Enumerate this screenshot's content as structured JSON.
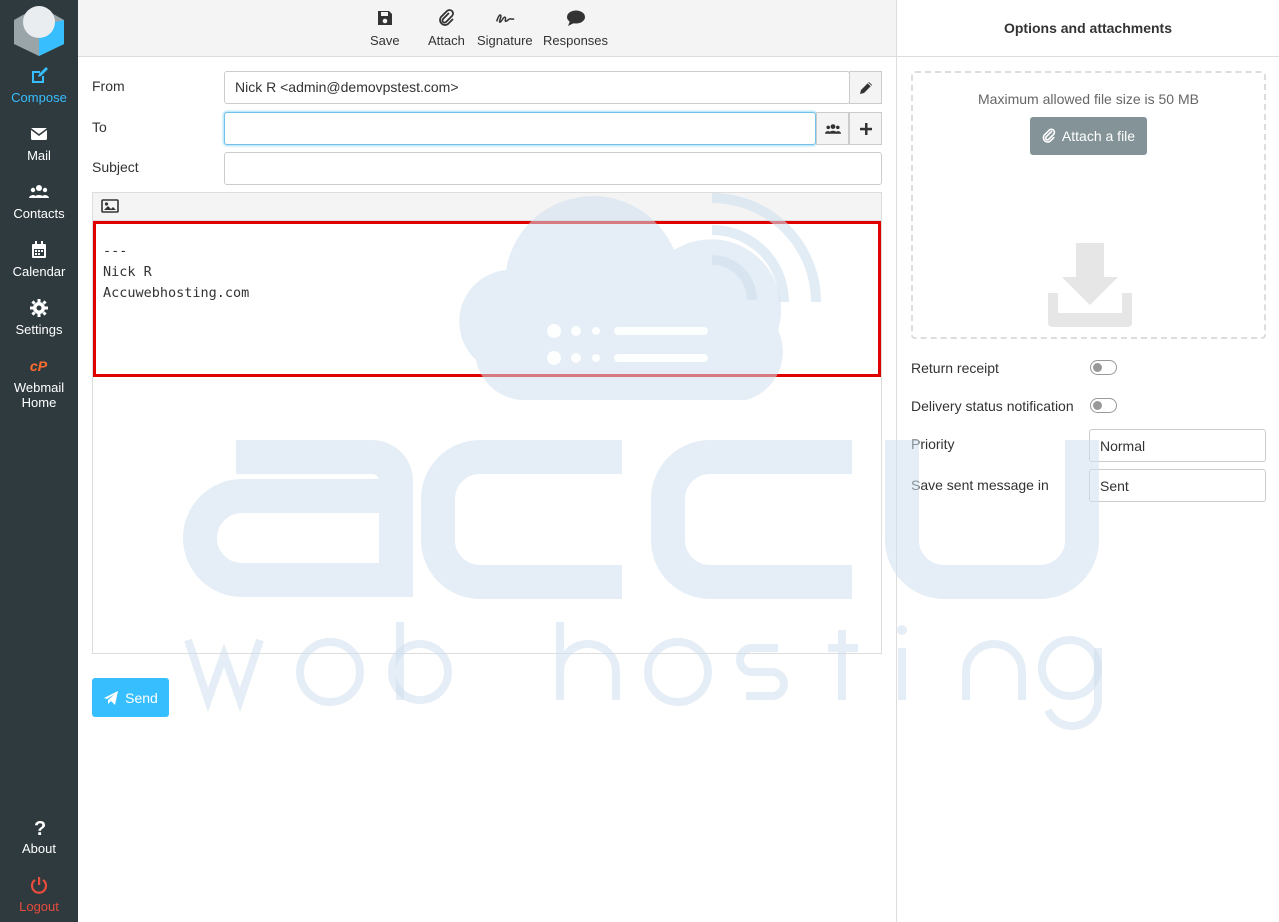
{
  "sidebar": {
    "items": [
      {
        "label": "Compose",
        "icon": "compose-icon"
      },
      {
        "label": "Mail",
        "icon": "envelope-icon"
      },
      {
        "label": "Contacts",
        "icon": "users-icon"
      },
      {
        "label": "Calendar",
        "icon": "calendar-icon"
      },
      {
        "label": "Settings",
        "icon": "gear-icon"
      },
      {
        "label_line1": "Webmail",
        "label_line2": "Home",
        "icon": "cpanel-icon"
      }
    ],
    "about": "About",
    "logout": "Logout"
  },
  "toolbar": {
    "save": "Save",
    "attach": "Attach",
    "signature": "Signature",
    "responses": "Responses"
  },
  "compose": {
    "from_label": "From",
    "from_value": "Nick R <admin@demovpstest.com>",
    "to_label": "To",
    "to_value": "",
    "subject_label": "Subject",
    "subject_value": "",
    "body_signature": "---\nNick R\nAccuwebhosting.com",
    "send": "Send"
  },
  "options": {
    "header": "Options and attachments",
    "max_size_text": "Maximum allowed file size is 50 MB",
    "attach_button": "Attach a file",
    "return_receipt": "Return receipt",
    "return_receipt_on": false,
    "dsn": "Delivery status notification",
    "dsn_on": false,
    "priority_label": "Priority",
    "priority_value": "Normal",
    "save_sent_label": "Save sent message in",
    "save_sent_value": "Sent"
  },
  "colors": {
    "accent": "#37beff",
    "sidebar_bg": "#2f3a3f",
    "logout": "#e74c3c",
    "highlight": "#e00000",
    "watermark": "#dbe7f0"
  }
}
